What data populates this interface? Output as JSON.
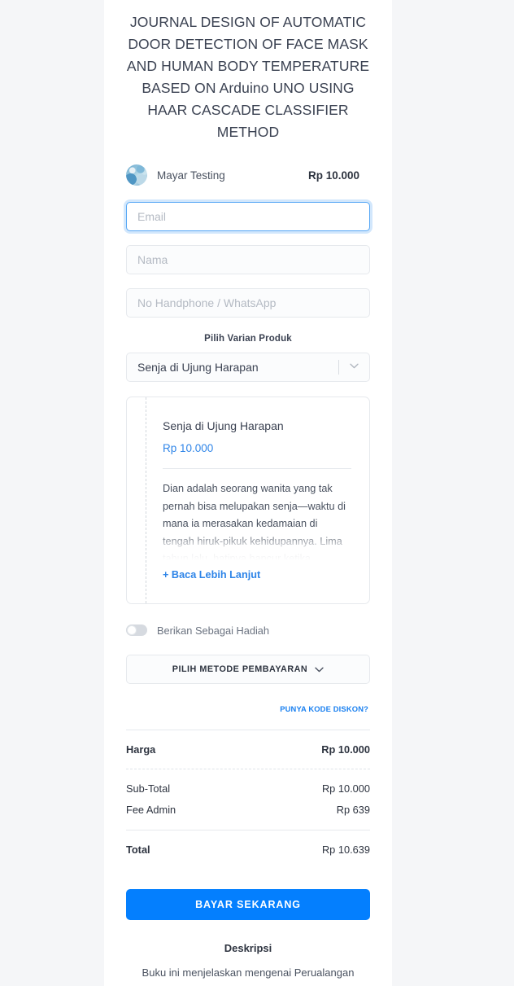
{
  "product": {
    "title": "JOURNAL DESIGN OF AUTOMATIC DOOR DETECTION OF FACE MASK AND HUMAN BODY TEMPERATURE BASED ON Arduino UNO USING HAAR CASCADE CLASSIFIER METHOD",
    "seller_name": "Mayar Testing",
    "price": "Rp 10.000"
  },
  "form": {
    "email_placeholder": "Email",
    "email_value": "",
    "nama_placeholder": "Nama",
    "nama_value": "",
    "phone_placeholder": "No Handphone / WhatsApp",
    "phone_value": ""
  },
  "variant": {
    "section_label": "Pilih Varian Produk",
    "selected": "Senja di Ujung Harapan",
    "card_title": "Senja di Ujung Harapan",
    "card_price": "Rp 10.000",
    "description": "Dian adalah seorang wanita yang tak pernah bisa melupakan senja—waktu di mana ia merasakan kedamaian di tengah hiruk-pikuk kehidupannya. Lima tahun lalu, hatinya hancur ketika Rangga, lelaki",
    "read_more": "+ Baca Lebih Lanjut"
  },
  "gift": {
    "label": "Berikan Sebagai Hadiah",
    "enabled": false
  },
  "payment": {
    "method_label": "PILIH METODE PEMBAYARAN",
    "discount_link": "PUNYA KODE DISKON?"
  },
  "summary": {
    "harga_label": "Harga",
    "harga_value": "Rp 10.000",
    "subtotal_label": "Sub-Total",
    "subtotal_value": "Rp 10.000",
    "fee_label": "Fee Admin",
    "fee_value": "Rp 639",
    "total_label": "Total",
    "total_value": "Rp 10.639"
  },
  "cta": {
    "label": "BAYAR SEKARANG"
  },
  "description": {
    "heading": "Deskripsi",
    "body": "Buku ini menjelaskan mengenai Perualangan"
  },
  "colors": {
    "accent_blue": "#047ffe",
    "link_blue": "#2f85e8",
    "page_bg": "#f5f6f8"
  }
}
